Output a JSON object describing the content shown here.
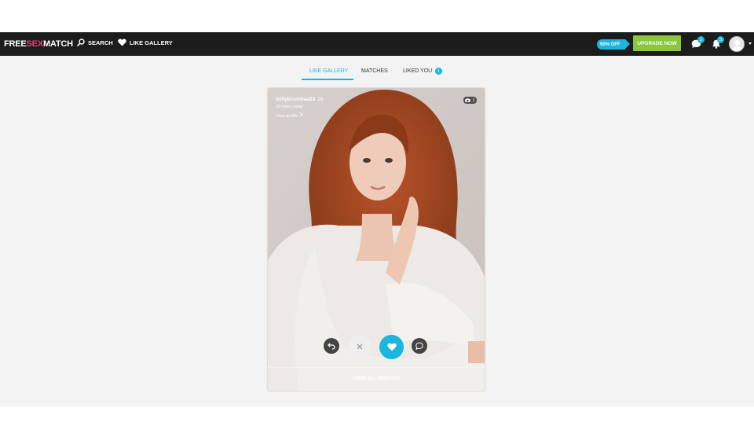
{
  "header": {
    "logo": {
      "part1": "FREE",
      "part2": "SEX",
      "part3": "MATCH"
    },
    "nav": [
      {
        "label": "SEARCH",
        "icon": "search-icon"
      },
      {
        "label": "LIKE GALLERY",
        "icon": "heart-icon"
      }
    ],
    "promo_label": "90% OFF",
    "upgrade_label": "UPGRADE NOW",
    "messages_count": "2",
    "notifications_count": "3"
  },
  "tabs": [
    {
      "label": "LIKE GALLERY",
      "active": true
    },
    {
      "label": "MATCHES",
      "active": false
    },
    {
      "label": "LIKED YOU",
      "active": false,
      "badge": "1"
    }
  ],
  "profile": {
    "username": "millykcumbaa23",
    "age": "26",
    "distance": "10 miles away",
    "view_profile": "View profile",
    "photo_count": "1",
    "view_all_photos": "VIEW ALL PHOTOS"
  },
  "colors": {
    "accent": "#1ab6dd",
    "upgrade": "#8cc63f",
    "logo_accent": "#e8417e",
    "topbar": "#1c1c1c"
  }
}
